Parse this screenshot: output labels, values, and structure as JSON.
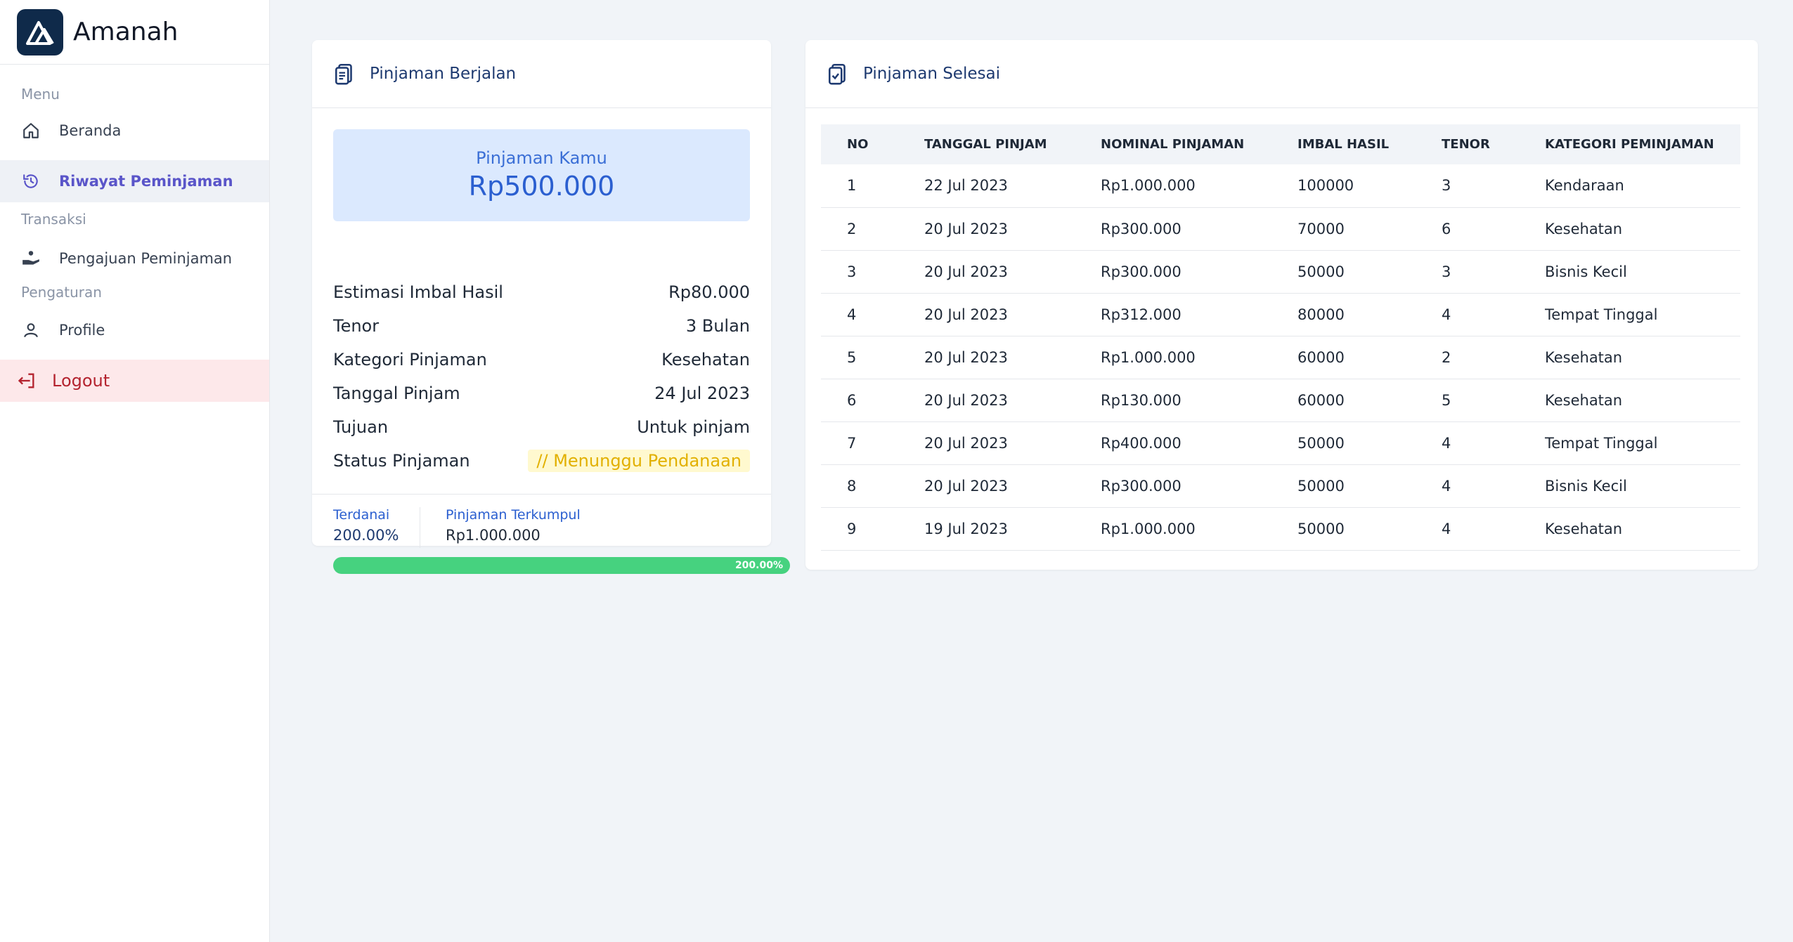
{
  "brand": {
    "name": "Amanah"
  },
  "sidebar": {
    "sections": {
      "menu": "Menu",
      "transaksi": "Transaksi",
      "pengaturan": "Pengaturan"
    },
    "items": {
      "beranda": "Beranda",
      "riwayat": "Riwayat Peminjaman",
      "pengajuan": "Pengajuan Peminjaman",
      "profile": "Profile",
      "logout": "Logout"
    }
  },
  "loan": {
    "header": "Pinjaman Berjalan",
    "box_label": "Pinjaman Kamu",
    "box_value": "Rp500.000",
    "details": [
      {
        "label": "Estimasi Imbal Hasil",
        "value": "Rp80.000"
      },
      {
        "label": "Tenor",
        "value": "3 Bulan"
      },
      {
        "label": "Kategori Pinjaman",
        "value": "Kesehatan"
      },
      {
        "label": "Tanggal Pinjam",
        "value": "24 Jul 2023"
      },
      {
        "label": "Tujuan",
        "value": "Untuk pinjam"
      }
    ],
    "status_label": "Status Pinjaman",
    "status_value": "// Menunggu Pendanaan",
    "funded_label": "Terdanai",
    "funded_value": "200.00%",
    "collected_label": "Pinjaman Terkumpul",
    "collected_value": "Rp1.000.000",
    "progress_text": "200.00%",
    "progress_percent": 200,
    "colors": {
      "progress": "#46d27f",
      "status": "#e2b000"
    }
  },
  "history": {
    "header": "Pinjaman Selesai",
    "columns": [
      "NO",
      "TANGGAL PINJAM",
      "NOMINAL PINJAMAN",
      "IMBAL HASIL",
      "TENOR",
      "KATEGORI PEMINJAMAN"
    ],
    "rows": [
      [
        "1",
        "22 Jul 2023",
        "Rp1.000.000",
        "100000",
        "3",
        "Kendaraan"
      ],
      [
        "2",
        "20 Jul 2023",
        "Rp300.000",
        "70000",
        "6",
        "Kesehatan"
      ],
      [
        "3",
        "20 Jul 2023",
        "Rp300.000",
        "50000",
        "3",
        "Bisnis Kecil"
      ],
      [
        "4",
        "20 Jul 2023",
        "Rp312.000",
        "80000",
        "4",
        "Tempat Tinggal"
      ],
      [
        "5",
        "20 Jul 2023",
        "Rp1.000.000",
        "60000",
        "2",
        "Kesehatan"
      ],
      [
        "6",
        "20 Jul 2023",
        "Rp130.000",
        "60000",
        "5",
        "Kesehatan"
      ],
      [
        "7",
        "20 Jul 2023",
        "Rp400.000",
        "50000",
        "4",
        "Tempat Tinggal"
      ],
      [
        "8",
        "20 Jul 2023",
        "Rp300.000",
        "50000",
        "4",
        "Bisnis Kecil"
      ],
      [
        "9",
        "19 Jul 2023",
        "Rp1.000.000",
        "50000",
        "4",
        "Kesehatan"
      ]
    ]
  }
}
